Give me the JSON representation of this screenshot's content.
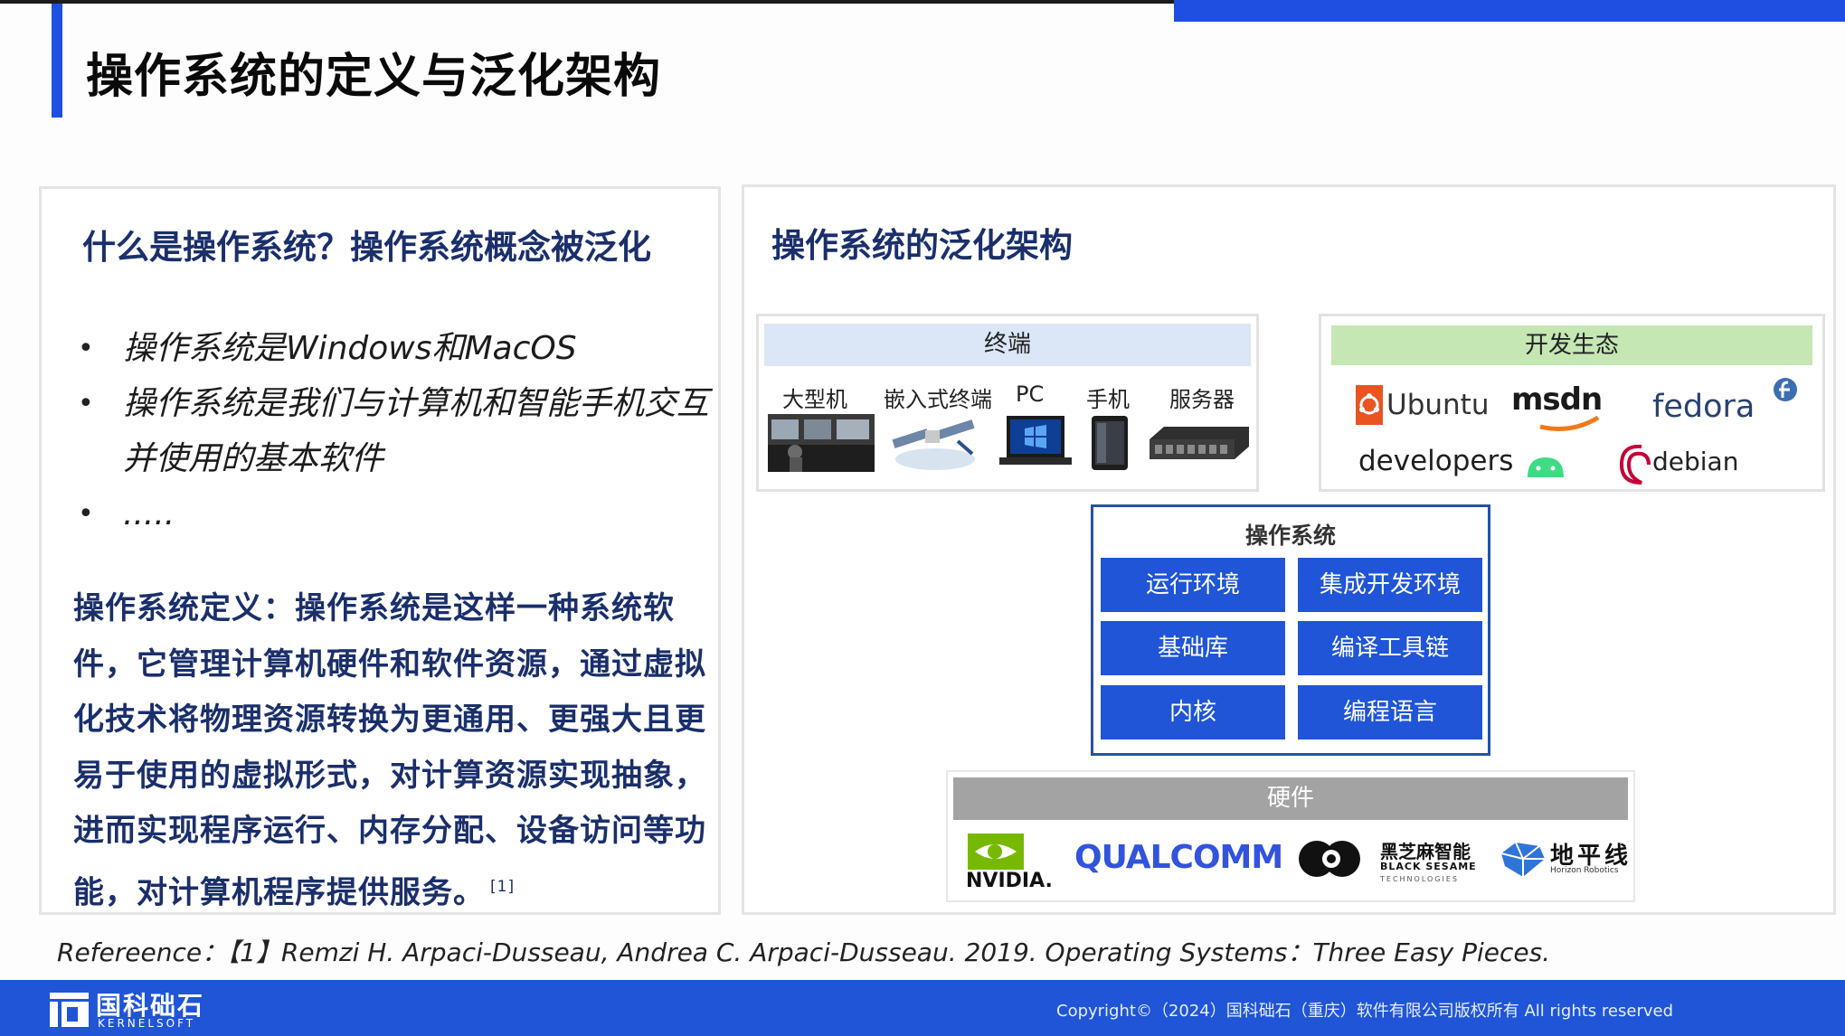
{
  "slide": {
    "title": "操作系统的定义与泛化架构"
  },
  "left_panel": {
    "heading": "什么是操作系统？操作系统概念被泛化",
    "bullets": [
      "操作系统是Windows和MacOS",
      "操作系统是我们与计算机和智能手机交互并使用的基本软件",
      "....."
    ],
    "definition": "操作系统定义：操作系统是这样一种系统软件，它管理计算机硬件和软件资源，通过虚拟化技术将物理资源转换为更通用、更强大且更易于使用的虚拟形式，对计算资源实现抽象，进而实现程序运行、内存分配、设备访问等功能，对计算机程序提供服务。",
    "definition_ref": "[1]"
  },
  "right_panel": {
    "heading": "操作系统的泛化架构",
    "terminal": {
      "header": "终端",
      "devices": [
        "大型机",
        "嵌入式终端",
        "PC",
        "手机",
        "服务器"
      ]
    },
    "ecosystem": {
      "header": "开发生态",
      "logos": [
        "Ubuntu",
        "msdn",
        "fedora",
        "developers",
        "debian"
      ]
    },
    "os": {
      "header": "操作系统",
      "components": [
        "运行环境",
        "集成开发环境",
        "基础库",
        "编译工具链",
        "内核",
        "编程语言"
      ]
    },
    "hardware": {
      "header": "硬件",
      "logos": {
        "nvidia": "NVIDIA.",
        "qualcomm": "QUALCOMM",
        "black_sesame_cn": "黑芝麻智能",
        "black_sesame_en": "BLACK SESAME",
        "black_sesame_sub": "TECHNOLOGIES",
        "horizon_cn": "地平线",
        "horizon_en": "Horizon Robotics"
      }
    }
  },
  "reference": "Refereence：【1】Remzi H. Arpaci-Dusseau, Andrea C. Arpaci-Dusseau. 2019. Operating Systems：Three Easy Pieces.",
  "footer": {
    "logo_cn": "国科础石",
    "logo_en": "KERNELSOFT",
    "copyright": "Copyright©（2024）国科础石（重庆）软件有限公司版权所有 All rights reserved"
  },
  "colors": {
    "accent_blue": "#1f55d6",
    "heading_navy": "#1a2f6b",
    "terminal_header": "#dbe6f6",
    "ecosystem_header": "#c5e7b4",
    "hardware_header": "#a3a3a3"
  }
}
